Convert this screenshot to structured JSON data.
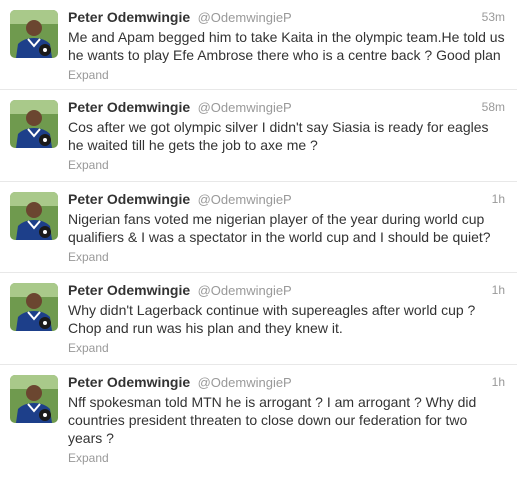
{
  "feed": {
    "tweets": [
      {
        "name": "Peter Odemwingie",
        "handle": "@OdemwingieP",
        "time": "53m",
        "text": "Me and Apam begged him to take Kaita in the olympic team.He told us he wants to play Efe Ambrose there who is a centre back ? Good plan",
        "expand": "Expand"
      },
      {
        "name": "Peter Odemwingie",
        "handle": "@OdemwingieP",
        "time": "58m",
        "text": "Cos after we got olympic silver I didn't say Siasia is ready for eagles he waited till he gets the job to axe me ?",
        "expand": "Expand"
      },
      {
        "name": "Peter Odemwingie",
        "handle": "@OdemwingieP",
        "time": "1h",
        "text": "Nigerian fans voted me nigerian player of the year during world cup qualifiers & I was a spectator in the world cup and I should be quiet?",
        "expand": "Expand"
      },
      {
        "name": "Peter Odemwingie",
        "handle": "@OdemwingieP",
        "time": "1h",
        "text": "Why didn't Lagerback continue with supereagles after world cup ? Chop and run was his plan and they knew it.",
        "expand": "Expand"
      },
      {
        "name": "Peter Odemwingie",
        "handle": "@OdemwingieP",
        "time": "1h",
        "text": "Nff spokesman told MTN he is arrogant ? I am arrogant ? Why did countries president threaten to close down our federation for two years ?",
        "expand": "Expand"
      }
    ]
  }
}
